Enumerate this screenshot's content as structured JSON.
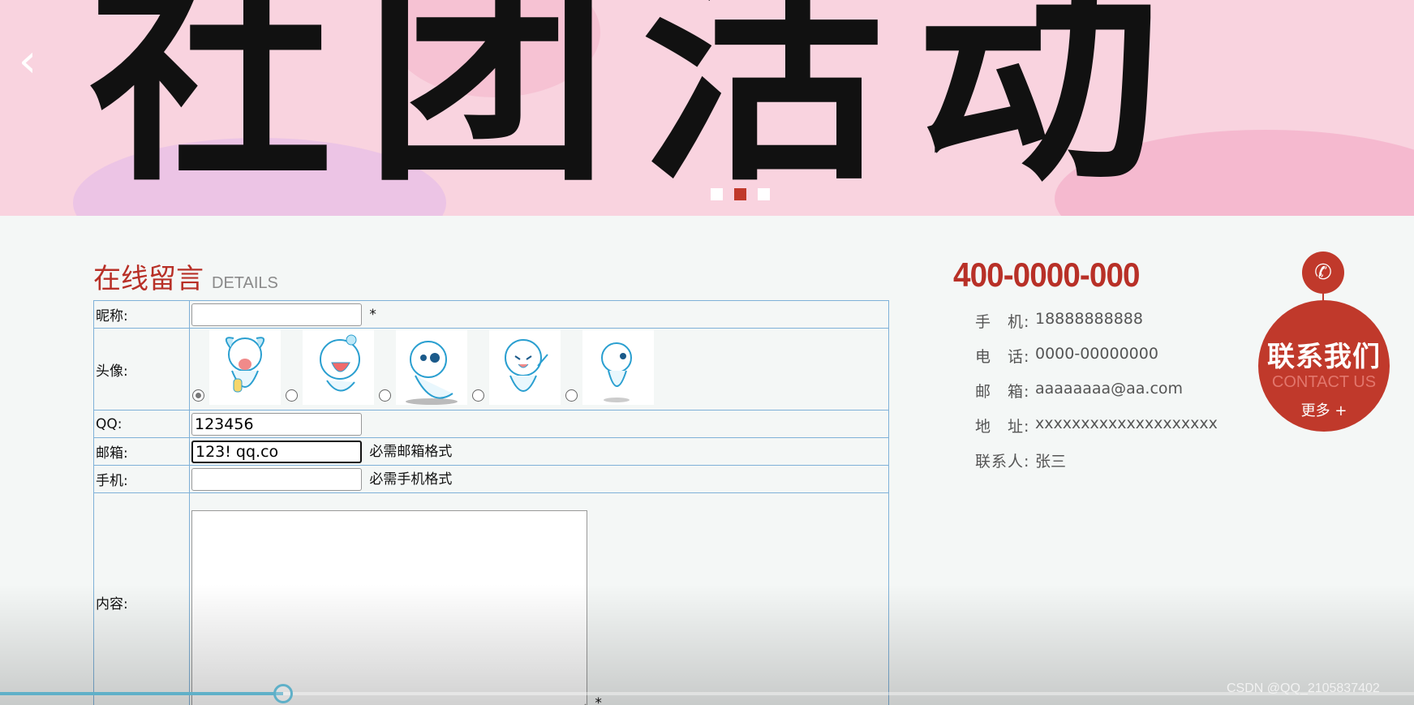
{
  "banner": {
    "title": "社团活动",
    "prev_icon": "‹",
    "slides_total": 3,
    "active_slide": 2
  },
  "section": {
    "title_cn": "在线留言",
    "title_en": "DETAILS"
  },
  "form": {
    "nickname": {
      "label": "昵称:",
      "value": "",
      "required_mark": "*"
    },
    "avatar": {
      "label": "头像:",
      "options_count": 5,
      "selected_index": 0
    },
    "qq": {
      "label": "QQ:",
      "value": "123456"
    },
    "email": {
      "label": "邮箱:",
      "value": "123! qq.co",
      "hint": "必需邮箱格式"
    },
    "mobile": {
      "label": "手机:",
      "value": "",
      "hint": "必需手机格式"
    },
    "content": {
      "label": "内容:",
      "value": "",
      "required_mark": "*"
    }
  },
  "contact": {
    "hotline": "400-0000-000",
    "items": [
      {
        "key": "手　机:",
        "value": "18888888888"
      },
      {
        "key": "电　话:",
        "value": "0000-00000000"
      },
      {
        "key": "邮　箱:",
        "value": "aaaaaaaa@aa.com"
      },
      {
        "key": "地　址:",
        "value": "xxxxxxxxxxxxxxxxxxxx"
      },
      {
        "key": "联系人:",
        "value": "张三"
      }
    ],
    "badge": {
      "phone_icon": "✆",
      "title_cn": "联系我们",
      "title_en": "CONTACT US",
      "more": "更多 +"
    }
  },
  "video": {
    "progress": 0.2
  },
  "watermark": "CSDN @QQ_2105837402",
  "colors": {
    "brand_red": "#b83027",
    "table_border": "#7fb1d8",
    "progress": "#5fb0c8"
  }
}
